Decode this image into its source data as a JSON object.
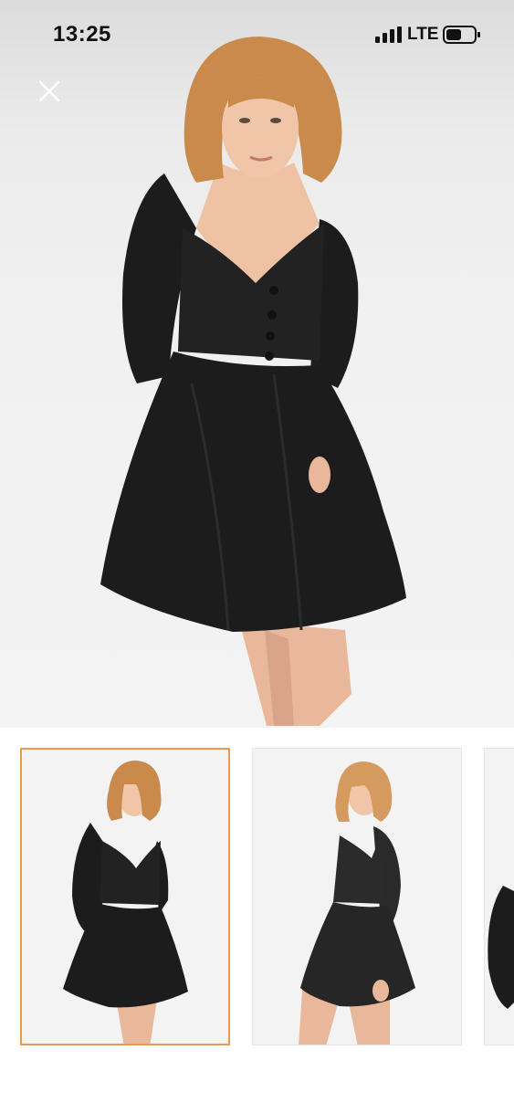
{
  "status_bar": {
    "time": "13:25",
    "network": "LTE",
    "battery_icon": "battery-icon",
    "signal_icon": "signal-bars-icon"
  },
  "viewer": {
    "close_icon": "close-icon",
    "main_image": "black-puff-sleeve-mini-dress-front-photo"
  },
  "thumbnails": [
    {
      "image": "dress-front-thumbnail",
      "selected": true
    },
    {
      "image": "dress-side-thumbnail",
      "selected": false
    },
    {
      "image": "dress-back-thumbnail-partial",
      "selected": false
    }
  ],
  "colors": {
    "selected_border": "#e89a52",
    "dress": "#1c1c1c",
    "background": "#f1f1f1"
  }
}
